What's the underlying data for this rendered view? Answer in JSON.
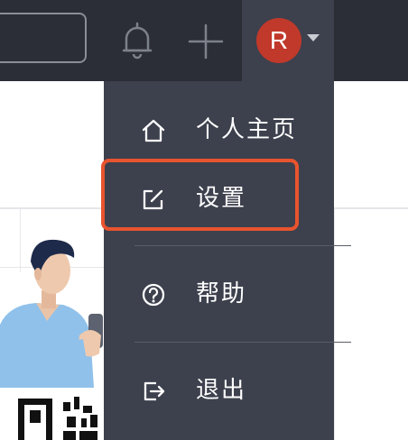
{
  "header": {
    "user_initial": "R"
  },
  "menu": {
    "items": [
      {
        "label": "个人主页",
        "icon": "home-icon"
      },
      {
        "label": "设置",
        "icon": "edit-icon"
      },
      {
        "label": "帮助",
        "icon": "help-circle-icon"
      },
      {
        "label": "退出",
        "icon": "logout-icon"
      }
    ]
  },
  "colors": {
    "topbar": "#2b2e36",
    "dropdown": "#3d404d",
    "avatar": "#c0392b",
    "highlight": "#e8542e"
  }
}
